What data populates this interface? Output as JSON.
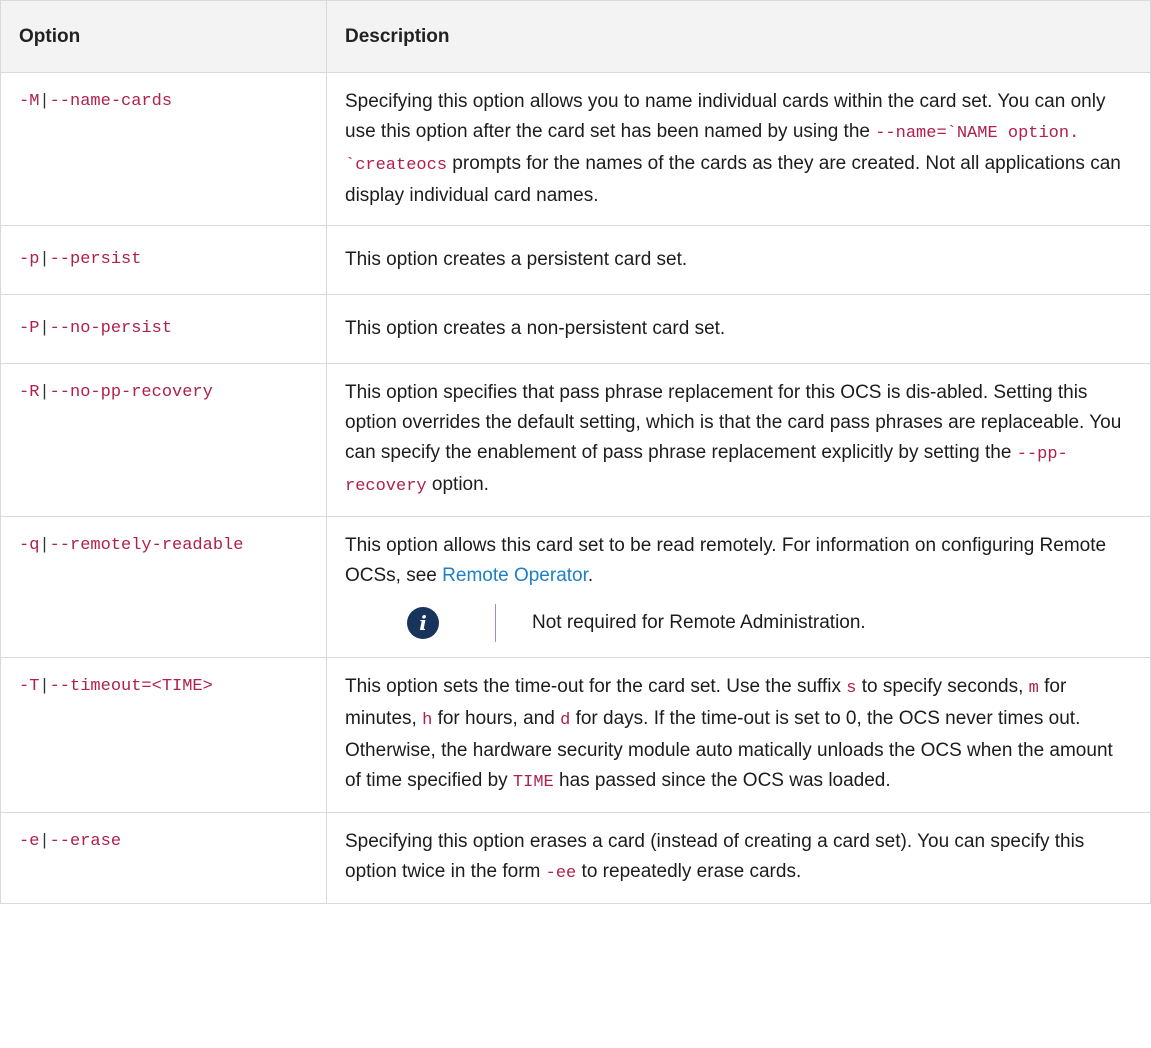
{
  "header": {
    "option": "Option",
    "description": "Description"
  },
  "rows": [
    {
      "opt_short": "-M",
      "opt_long": "--name-cards",
      "desc_parts": [
        "Specifying this option allows you to name individual cards within the card set. You can only use this option after the card set has been named by using the ",
        "--name=`",
        "NAME option. `createocs",
        " prompts for the names of the cards as they are created. Not all applications can display individual card names."
      ]
    },
    {
      "opt_short": "-p",
      "opt_long": "--persist",
      "desc": "This option creates a persistent card set."
    },
    {
      "opt_short": "-P",
      "opt_long": "--no-persist",
      "desc": "This option creates a non-persistent card set."
    },
    {
      "opt_short": "-R",
      "opt_long": "--no-pp-recovery",
      "desc_parts": [
        "This option specifies that pass phrase replacement for this OCS is dis-abled. Setting this option overrides the default setting, which is that the card pass phrases are replaceable. You can specify the enablement of pass phrase replacement explicitly by setting the ",
        "--pp-recovery",
        " option."
      ]
    },
    {
      "opt_short": "-q",
      "opt_long": "--remotely-readable",
      "desc_before_link": "This option allows this card set to be read remotely. For information on configuring Remote OCSs, see ",
      "link": "Remote Operator",
      "desc_after_link": ".",
      "note": "Not required for Remote Administration.",
      "note_icon": "info-icon"
    },
    {
      "opt_short": "-T",
      "opt_long": "--timeout=<TIME>",
      "desc_parts": [
        "This option sets the time-out for the card set. Use the suffix ",
        "s",
        " to specify seconds, ",
        "m",
        " for minutes, ",
        "h",
        " for hours, and ",
        "d",
        " for days. If the time-out is set to 0, the OCS never times out. Otherwise, the hardware security module auto matically unloads the OCS when the amount of time specified by ",
        "TIME",
        " has passed since the OCS was loaded."
      ]
    },
    {
      "opt_short": "-e",
      "opt_long": "--erase",
      "desc_parts": [
        "Specifying this option erases a card (instead of creating a card set). You can specify this option twice in the form ",
        "-ee",
        " to repeatedly erase cards."
      ]
    }
  ],
  "colors": {
    "code": "#b0204b",
    "link": "#1d7fc7",
    "header_bg": "#f3f3f3",
    "note_icon_bg": "#19345c",
    "note_bar": "#a38bc2"
  }
}
